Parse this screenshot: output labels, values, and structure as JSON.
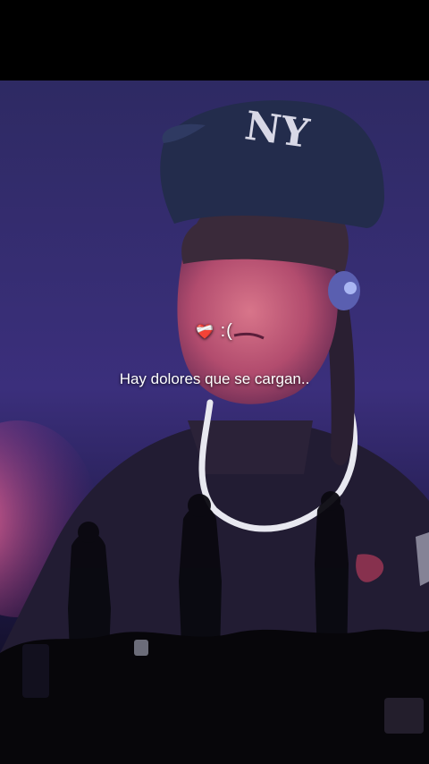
{
  "caption": {
    "emoji": "❤‍🩹",
    "emoticon": ":(",
    "text": "Hay dolores que se cargan.."
  },
  "icons": [
    "mending-heart-icon",
    "ny-cap-logo-icon"
  ],
  "colors": {
    "background_top": "#000000",
    "scene_purple": "#3a2f7a",
    "stage_pink": "#e0507e",
    "caption_text": "#ffffff"
  }
}
